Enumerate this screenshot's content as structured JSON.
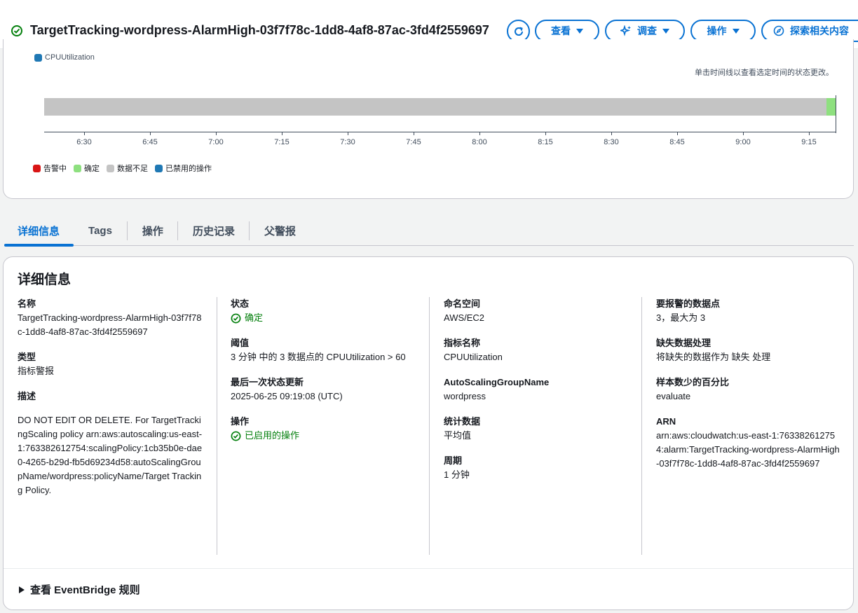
{
  "header": {
    "title": "TargetTracking-wordpress-AlarmHigh-03f7f78c-1dd8-4af8-87ac-3fd4f2559697",
    "status_icon": "check-circle-icon",
    "refresh_icon": "refresh-icon",
    "view_label": "查看",
    "investigate_label": "调查",
    "investigate_icon": "sparkle-icon",
    "actions_label": "操作",
    "explore_label": "探索相关内容",
    "explore_icon": "compass-icon"
  },
  "timeline": {
    "metric_legend": "CPUUtilization",
    "hint": "单击时间线以查看选定时间的状态更改。",
    "ticks": [
      "6:30",
      "6:45",
      "7:00",
      "7:15",
      "7:30",
      "7:45",
      "8:00",
      "8:15",
      "8:30",
      "8:45",
      "9:00",
      "9:15"
    ],
    "legend": [
      {
        "label": "告警中",
        "color": "#d91515"
      },
      {
        "label": "确定",
        "color": "#8ee07f"
      },
      {
        "label": "数据不足",
        "color": "#c4c4c4"
      },
      {
        "label": "已禁用的操作",
        "color": "#1f78b4"
      }
    ],
    "segments": [
      {
        "state": "数据不足",
        "fraction": 0.987
      },
      {
        "state": "确定",
        "fraction": 0.013
      }
    ]
  },
  "tabs": [
    "详细信息",
    "Tags",
    "操作",
    "历史记录",
    "父警报"
  ],
  "details": {
    "title": "详细信息",
    "col1": {
      "name_label": "名称",
      "name_value": "TargetTracking-wordpress-AlarmHigh-03f7f78c-1dd8-4af8-87ac-3fd4f2559697",
      "type_label": "类型",
      "type_value": "指标警报",
      "desc_label": "描述",
      "desc_value": "DO NOT EDIT OR DELETE. For TargetTrackingScaling policy arn:aws:autoscaling:us-east-1:763382612754:scalingPolicy:1cb35b0e-dae0-4265-b29d-fb5d69234d58:autoScalingGroupName/wordpress:policyName/Target Tracking Policy."
    },
    "col2": {
      "state_label": "状态",
      "state_value": "确定",
      "threshold_label": "阈值",
      "threshold_value": "3 分钟 中的 3 数据点的 CPUUtilization > 60",
      "last_update_label": "最后一次状态更新",
      "last_update_value": "2025-06-25 09:19:08 (UTC)",
      "actions_label": "操作",
      "actions_value": "已启用的操作"
    },
    "col3": {
      "namespace_label": "命名空间",
      "namespace_value": "AWS/EC2",
      "metric_label": "指标名称",
      "metric_value": "CPUUtilization",
      "asg_label": "AutoScalingGroupName",
      "asg_value": "wordpress",
      "stat_label": "统计数据",
      "stat_value": "平均值",
      "period_label": "周期",
      "period_value": "1 分钟"
    },
    "col4": {
      "datapoints_label": "要报警的数据点",
      "datapoints_value": "3，最大为 3",
      "missing_label": "缺失数据处理",
      "missing_value": "将缺失的数据作为 缺失 处理",
      "percentile_label": "样本数少的百分比",
      "percentile_value": "evaluate",
      "arn_label": "ARN",
      "arn_value": "arn:aws:cloudwatch:us-east-1:763382612754:alarm:TargetTracking-wordpress-AlarmHigh-03f7f78c-1dd8-4af8-87ac-3fd4f2559697"
    },
    "eventbridge_label": "查看 EventBridge 规则"
  }
}
